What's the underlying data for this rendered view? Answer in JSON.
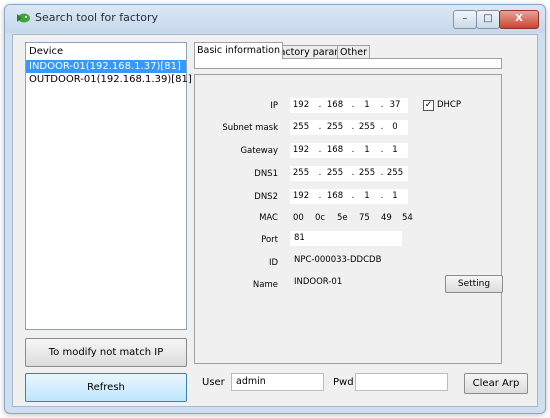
{
  "window": {
    "title": "Search tool for factory",
    "minimize_glyph": "–",
    "maximize_glyph": "□",
    "close_glyph": "X"
  },
  "device_list": {
    "header": "Device",
    "items": [
      {
        "label": "INDOOR-01(192.168.1.37)[81]",
        "selected": true
      },
      {
        "label": "OUTDOOR-01(192.168.1.39)[81]",
        "selected": false
      }
    ]
  },
  "buttons": {
    "modify_ip": "To modify not match IP",
    "refresh": "Refresh",
    "setting": "Setting",
    "clear_arp": "Clear Arp"
  },
  "tabs": [
    {
      "label": "Basic information",
      "active": true
    },
    {
      "label": "Factory param",
      "active": false
    },
    {
      "label": "Other",
      "active": false
    }
  ],
  "form": {
    "ip": {
      "label": "IP",
      "octets": [
        "192",
        "168",
        "1",
        "37"
      ]
    },
    "dhcp": {
      "label": "DHCP",
      "checked": true
    },
    "subnet_mask": {
      "label": "Subnet mask",
      "octets": [
        "255",
        "255",
        "255",
        "0"
      ]
    },
    "gateway": {
      "label": "Gateway",
      "octets": [
        "192",
        "168",
        "1",
        "1"
      ]
    },
    "dns1": {
      "label": "DNS1",
      "octets": [
        "255",
        "255",
        "255",
        "255"
      ]
    },
    "dns2": {
      "label": "DNS2",
      "octets": [
        "192",
        "168",
        "1",
        "1"
      ]
    },
    "mac": {
      "label": "MAC",
      "bytes": [
        "00",
        "0c",
        "5e",
        "75",
        "49",
        "54"
      ]
    },
    "port": {
      "label": "Port",
      "value": "81"
    },
    "id": {
      "label": "ID",
      "value": "NPC-000033-DDCDB"
    },
    "name": {
      "label": "Name",
      "value": "INDOOR-01"
    }
  },
  "login": {
    "user_label": "User",
    "user_value": "admin",
    "pwd_label": "Pwd",
    "pwd_value": ""
  },
  "ip_separator": ".",
  "colors": {
    "selection": "#3399ff",
    "title_bar": "#cfdff0",
    "close_button": "#c9452f"
  }
}
